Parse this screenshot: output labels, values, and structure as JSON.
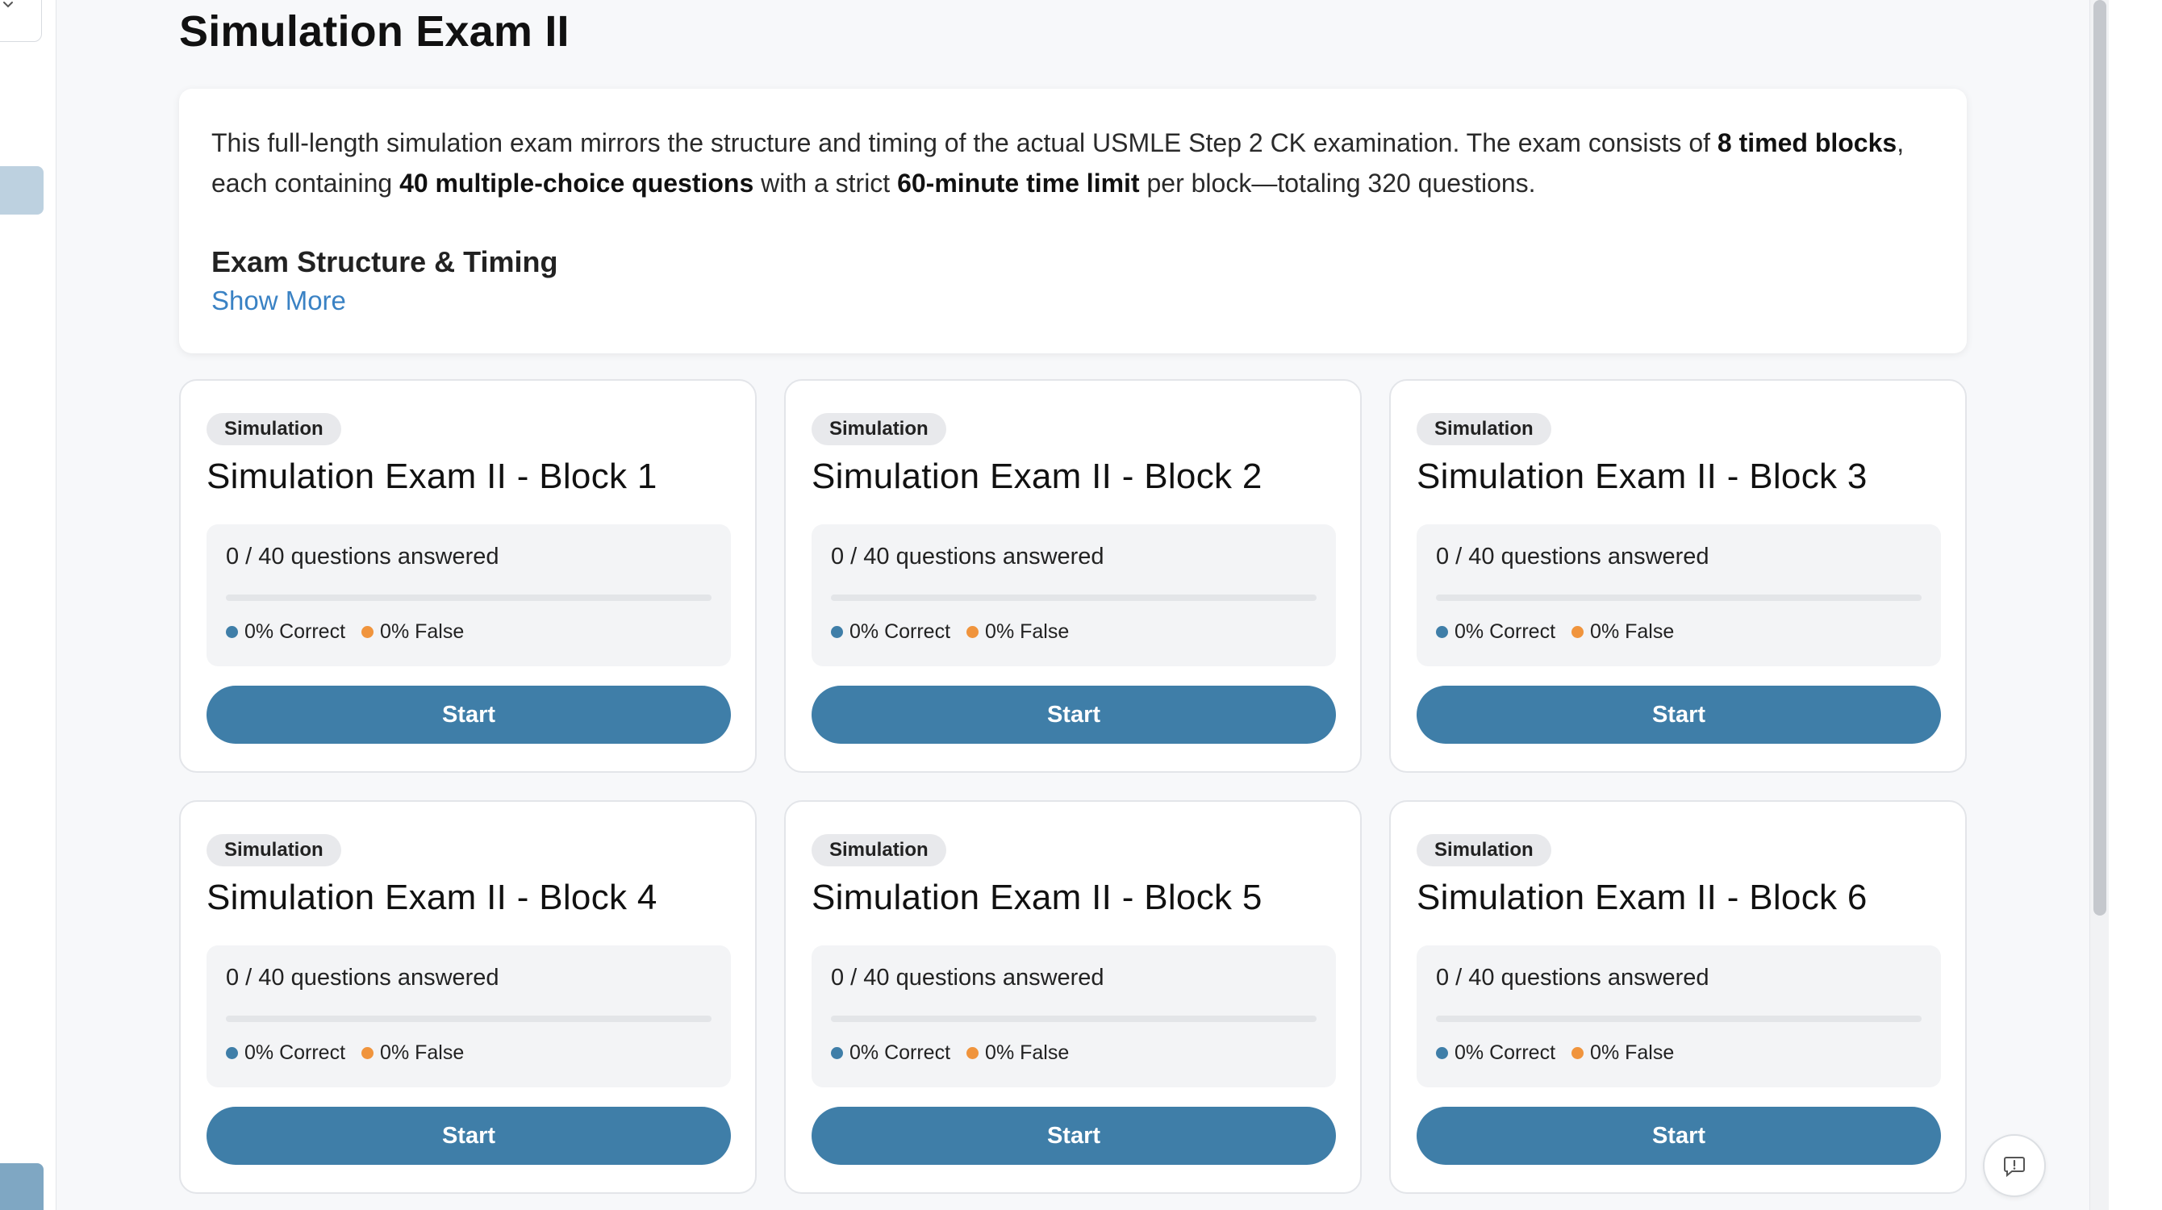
{
  "page": {
    "title": "Simulation Exam II"
  },
  "description": {
    "intro_1": "This full-length simulation exam mirrors the structure and timing of the actual USMLE Step 2 CK examination. The exam consists of ",
    "bold_1": "8 timed blocks",
    "intro_2": ", each containing ",
    "bold_2": "40 multiple-choice questions",
    "intro_3": " with a strict ",
    "bold_3": "60-minute time limit",
    "intro_4": " per block—totaling 320 questions.",
    "heading": "Exam Structure & Timing",
    "show_more": "Show More"
  },
  "blocks": [
    {
      "badge": "Simulation",
      "title": "Simulation Exam II - Block 1",
      "progress": "0 / 40 questions answered",
      "progress_fraction": 0,
      "correct": "0% Correct",
      "false": "0% False",
      "button": "Start"
    },
    {
      "badge": "Simulation",
      "title": "Simulation Exam II - Block 2",
      "progress": "0 / 40 questions answered",
      "progress_fraction": 0,
      "correct": "0% Correct",
      "false": "0% False",
      "button": "Start"
    },
    {
      "badge": "Simulation",
      "title": "Simulation Exam II - Block 3",
      "progress": "0 / 40 questions answered",
      "progress_fraction": 0,
      "correct": "0% Correct",
      "false": "0% False",
      "button": "Start"
    },
    {
      "badge": "Simulation",
      "title": "Simulation Exam II - Block 4",
      "progress": "0 / 40 questions answered",
      "progress_fraction": 0,
      "correct": "0% Correct",
      "false": "0% False",
      "button": "Start"
    },
    {
      "badge": "Simulation",
      "title": "Simulation Exam II - Block 5",
      "progress": "0 / 40 questions answered",
      "progress_fraction": 0,
      "correct": "0% Correct",
      "false": "0% False",
      "button": "Start"
    },
    {
      "badge": "Simulation",
      "title": "Simulation Exam II - Block 6",
      "progress": "0 / 40 questions answered",
      "progress_fraction": 0,
      "correct": "0% Correct",
      "false": "0% False",
      "button": "Start"
    }
  ],
  "colors": {
    "accent": "#3f7ea8",
    "correct": "#3f7ea8",
    "false": "#f0943d",
    "link": "#3a82c4"
  },
  "icons": {
    "dropdown": "chevron-down-icon",
    "feedback": "feedback-icon"
  }
}
